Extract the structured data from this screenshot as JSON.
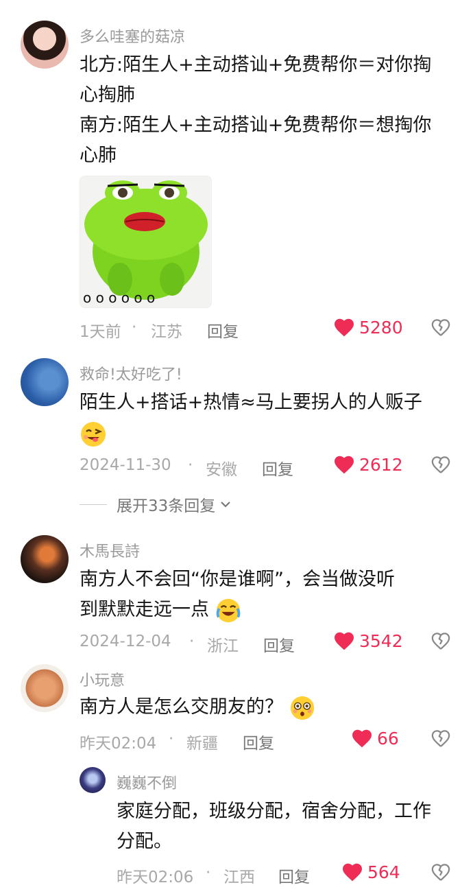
{
  "comments": [
    {
      "username": "多么哇塞的菇凉",
      "lines": [
        "北方:陌生人+主动搭讪+免费帮你＝对你掏",
        "心掏肺",
        "南方:陌生人+主动搭讪+免费帮你＝想掏你",
        "心肺"
      ],
      "sticker_caption": "o o o o o o",
      "time": "1天前",
      "location": "江苏",
      "reply_label": "回复",
      "likes": "5280"
    },
    {
      "username": "救命!太好吃了!",
      "lines": [
        "陌生人+搭话+热情≈马上要拐人的人贩子"
      ],
      "emoji": "wink-tongue-emoji",
      "time": "2024-11-30",
      "location": "安徽",
      "reply_label": "回复",
      "likes": "2612",
      "expand_label": "展开33条回复"
    },
    {
      "username": "木馬長詩",
      "lines": [
        "南方人不会回“你是谁啊”，会当做没听",
        "到默默走远一点"
      ],
      "emoji": "crying-laughing-emoji",
      "time": "2024-12-04",
      "location": "浙江",
      "reply_label": "回复",
      "likes": "3542"
    },
    {
      "username": "小玩意",
      "lines": [
        "南方人是怎么交朋友的？"
      ],
      "emoji": "flushed-emoji",
      "time": "昨天02:04",
      "location": "新疆",
      "reply_label": "回复",
      "likes": "66"
    },
    {
      "username": "巍巍不倒",
      "lines": [
        "家庭分配，班级分配，宿舍分配，工作",
        "分配。"
      ],
      "time": "昨天02:06",
      "location": "江西",
      "reply_label": "回复",
      "likes": "564"
    }
  ],
  "separator": "·",
  "colors": {
    "like": "#ef2c55",
    "meta": "#a8a8a8",
    "username": "#9a9a9a"
  }
}
